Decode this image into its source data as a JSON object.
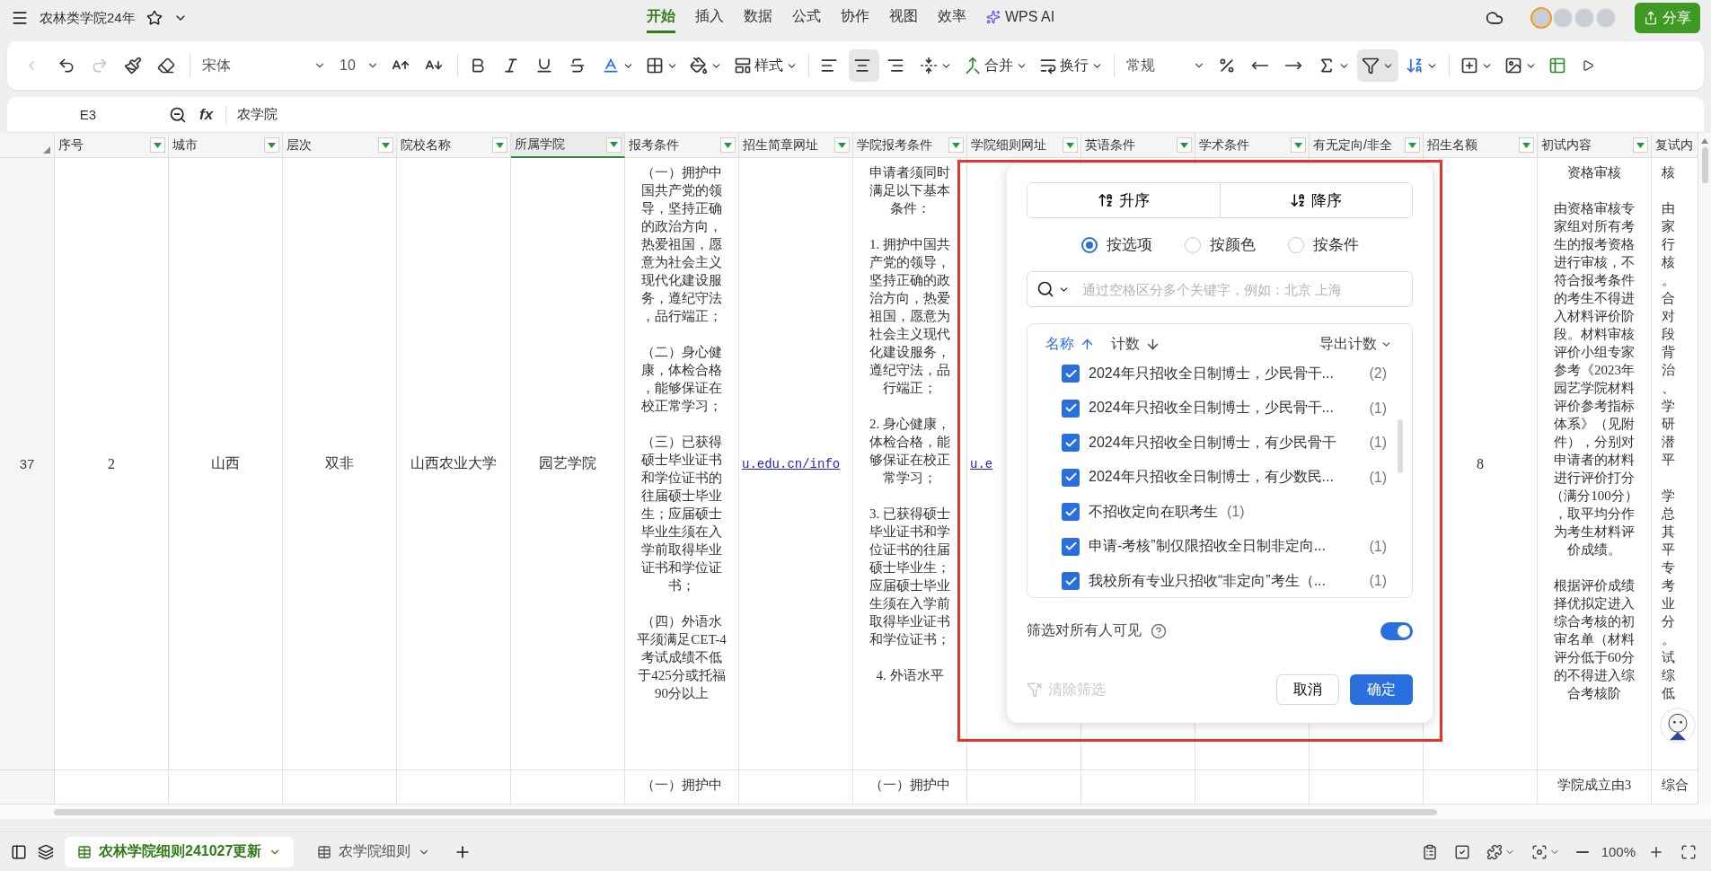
{
  "app_bar": {
    "title": "农林类学院24年",
    "menu_tabs": [
      {
        "label": "开始",
        "selected": true,
        "kind": "plain"
      },
      {
        "label": "插入",
        "selected": false,
        "kind": "plain"
      },
      {
        "label": "数据",
        "selected": false,
        "kind": "plain"
      },
      {
        "label": "公式",
        "selected": false,
        "kind": "plain"
      },
      {
        "label": "协作",
        "selected": false,
        "kind": "plain"
      },
      {
        "label": "视图",
        "selected": false,
        "kind": "plain"
      },
      {
        "label": "效率",
        "selected": false,
        "kind": "plain"
      },
      {
        "label": "WPS AI",
        "selected": false,
        "kind": "ai"
      }
    ],
    "share_button": "分享"
  },
  "toolbar": {
    "history_buttons": [
      {
        "kind": "back",
        "disabled": true
      },
      {
        "kind": "undo",
        "disabled": false
      },
      {
        "kind": "redo",
        "disabled": true
      }
    ],
    "font": "宋体",
    "font_size": "10",
    "style_button": "样式",
    "align_buttons": [
      {
        "kind": "left",
        "selected": false
      },
      {
        "kind": "center",
        "selected": true
      },
      {
        "kind": "right",
        "selected": false
      }
    ],
    "merge_button": "合并",
    "wrap_button": "换行",
    "number_format": "常规",
    "filter_button": {
      "active": true
    }
  },
  "formula_bar": {
    "cell_ref": "E3",
    "function_label": "fx",
    "value": "农学院"
  },
  "sheet": {
    "columns": [
      {
        "label": "序号",
        "selected": false
      },
      {
        "label": "城市",
        "selected": false
      },
      {
        "label": "层次",
        "selected": false
      },
      {
        "label": "院校名称",
        "selected": false
      },
      {
        "label": "所属学院",
        "selected": true
      },
      {
        "label": "报考条件",
        "selected": false
      },
      {
        "label": "招生简章网址",
        "selected": false
      },
      {
        "label": "学院报考条件",
        "selected": false
      },
      {
        "label": "学院细则网址",
        "selected": false
      },
      {
        "label": "英语条件",
        "selected": false
      },
      {
        "label": "学术条件",
        "selected": false
      },
      {
        "label": "有无定向/非全",
        "selected": false
      },
      {
        "label": "招生名额",
        "selected": false
      },
      {
        "label": "初试内容",
        "selected": false
      },
      {
        "label": "复试内",
        "selected": false
      }
    ],
    "rows": [
      {
        "header": "37",
        "cells": [
          {
            "kind": "value",
            "text": "2"
          },
          {
            "kind": "value",
            "text": "山西"
          },
          {
            "kind": "value",
            "text": "双非"
          },
          {
            "kind": "value",
            "text": "山西农业大学"
          },
          {
            "kind": "value",
            "text": "园艺学院"
          },
          {
            "kind": "paragraph",
            "paragraphs": [
              "（一）拥护中国共产党的领导，坚持正确的政治方向，热爱祖国，愿意为社会主义现代化建设服务，遵纪守法，品行端正；",
              "（二）身心健康，体检合格，能够保证在校正常学习；",
              "（三）已获得硕士毕业证书和学位证书的往届硕士毕业生；应届硕士毕业生须在入学前取得毕业证书和学位证书；",
              "（四）外语水平须满足CET-4考试成绩不低于425分或托福90分以上"
            ]
          },
          {
            "kind": "link",
            "text": "u.edu.cn/info"
          },
          {
            "kind": "paragraph",
            "paragraphs": [
              "申请者须同时满足以下基本条件：",
              "1. 拥护中国共产党的领导，坚持正确的政治方向，热爱祖国，愿意为社会主义现代化建设服务，遵纪守法，品行端正；",
              "2. 身心健康，体检合格，能够保证在校正常学习；",
              "3. 已获得硕士毕业证书和学位证书的往届硕士毕业生；应届硕士毕业生须在入学前取得毕业证书和学位证书；",
              "4. 外语水平"
            ]
          },
          {
            "kind": "link",
            "text": "u.e"
          },
          {
            "kind": "empty"
          },
          {
            "kind": "empty"
          },
          {
            "kind": "empty"
          },
          {
            "kind": "value",
            "text": "8"
          },
          {
            "kind": "paragraph",
            "paragraphs": [
              "资格审核",
              "由资格审核专家组对所有考生的报考资格进行审核，不符合报考条件的考生不得进入材料评价阶段。材料审核评价小组专家参考《2023年园艺学院材料评价参考指标体系》（见附件），分别对申请者的材料进行评价打分（满分100分），取平均分作为考生材料评价成绩。",
              "根据评价成绩择优拟定进入综合考核的初审名单（材料评分低于60分的不得进入综合考核阶"
            ]
          },
          {
            "kind": "clipped",
            "paragraphs": [
              "核",
              "由家行核。合对段背治、学研潜平",
              "学总其平专考业分。试综低"
            ]
          }
        ]
      },
      {
        "header": "",
        "cells": [
          {
            "kind": "empty"
          },
          {
            "kind": "empty"
          },
          {
            "kind": "empty"
          },
          {
            "kind": "empty"
          },
          {
            "kind": "empty"
          },
          {
            "kind": "paragraph",
            "paragraphs": [
              "（一）拥护中"
            ]
          },
          {
            "kind": "empty"
          },
          {
            "kind": "paragraph",
            "paragraphs": [
              "（一）拥护中"
            ]
          },
          {
            "kind": "empty"
          },
          {
            "kind": "empty"
          },
          {
            "kind": "empty"
          },
          {
            "kind": "empty"
          },
          {
            "kind": "empty"
          },
          {
            "kind": "paragraph",
            "paragraphs": [
              "学院成立由3"
            ]
          },
          {
            "kind": "paragraph",
            "paragraphs": [
              "综合"
            ]
          }
        ]
      }
    ]
  },
  "filter_popup": {
    "sort_buttons": [
      {
        "kind": "ascending",
        "label": "升序"
      },
      {
        "kind": "descending",
        "label": "降序"
      }
    ],
    "modes": [
      {
        "label": "按选项",
        "selected": true
      },
      {
        "label": "按颜色",
        "selected": false
      },
      {
        "label": "按条件",
        "selected": false
      }
    ],
    "search": {
      "placeholder": "通过空格区分多个关键字，例如：北京 上海"
    },
    "sort_options": [
      {
        "label": "名称",
        "kind": "up",
        "selected": true
      },
      {
        "label": "计数",
        "kind": "down",
        "selected": false
      }
    ],
    "export_button": "导出计数",
    "items": [
      {
        "label": "2024年只招收全日制博士，少民骨干...",
        "count": "(2)",
        "checked": true
      },
      {
        "label": "2024年只招收全日制博士，少民骨干...",
        "count": "(1)",
        "checked": true
      },
      {
        "label": "2024年只招收全日制博士，有少民骨干",
        "count": "(1)",
        "checked": true
      },
      {
        "label": "2024年只招收全日制博士，有少数民...",
        "count": "(1)",
        "checked": true
      },
      {
        "label": "不招收定向在职考生",
        "count": "(1)",
        "checked": true
      },
      {
        "label": "申请-考核”制仅限招收全日制非定向...",
        "count": "(1)",
        "checked": true
      },
      {
        "label": "我校所有专业只招收“非定向”考生（...",
        "count": "(1)",
        "checked": true
      }
    ],
    "visibility": {
      "label": "筛选对所有人可见",
      "on": true
    },
    "clear_button": {
      "label": "清除筛选",
      "disabled": true
    },
    "cancel_button": "取消",
    "confirm_button": "确定"
  },
  "bottom_bar": {
    "sheet_tabs": [
      {
        "label": "农林学院细则241027更新",
        "selected": true
      },
      {
        "label": "农学院细则",
        "selected": false
      }
    ],
    "zoom": "100%"
  }
}
